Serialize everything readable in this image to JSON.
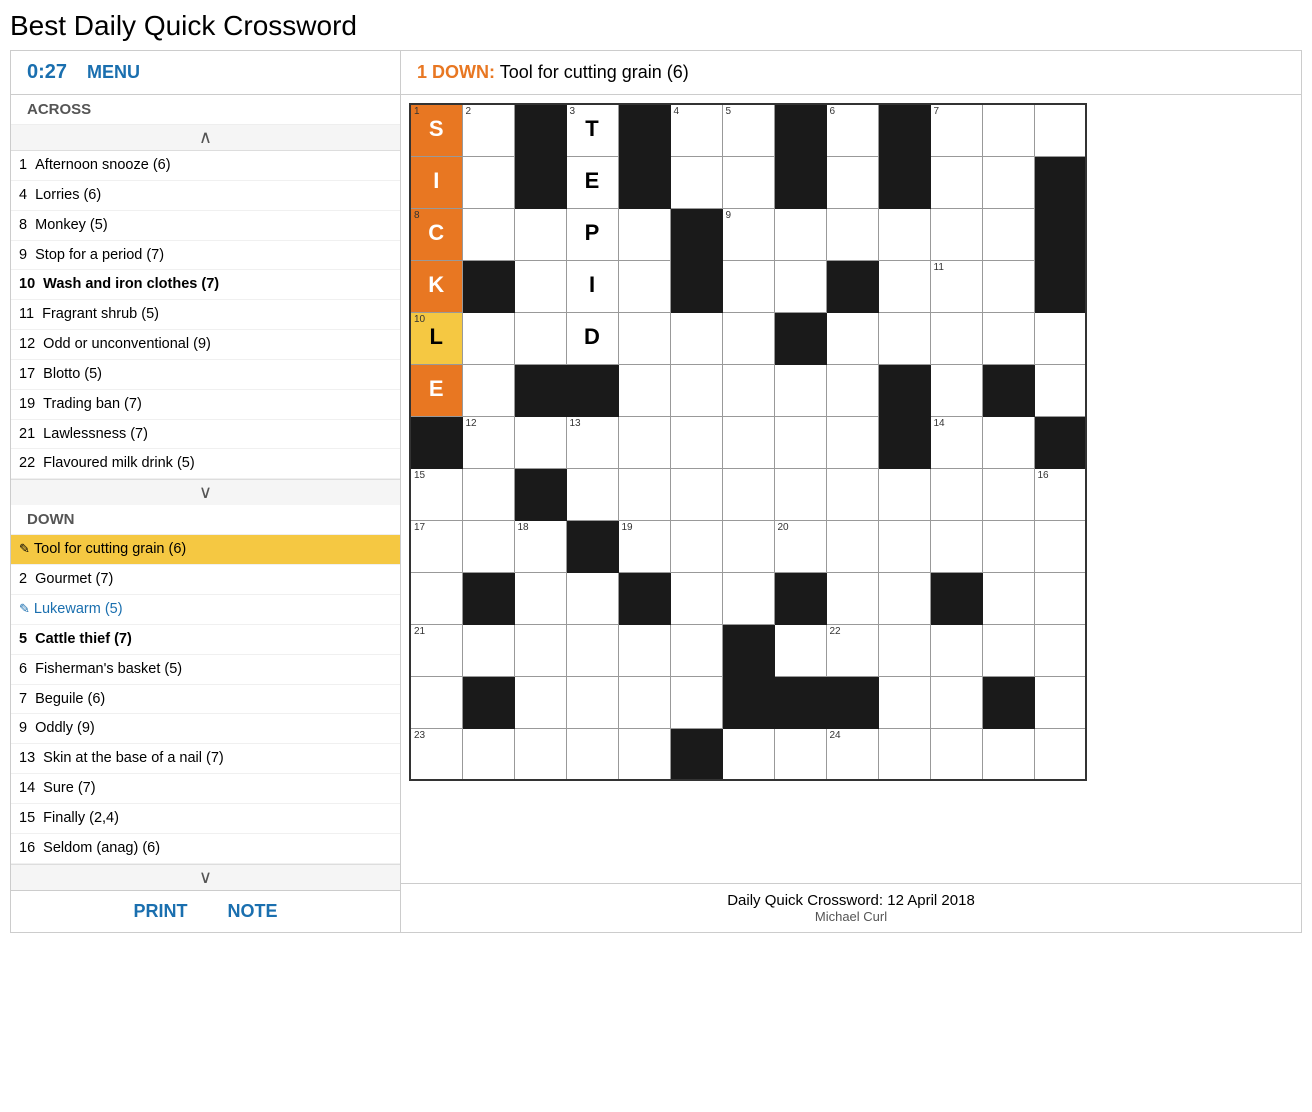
{
  "title": "Best Daily Quick Crossword",
  "header": {
    "timer": "0:27",
    "menu_label": "MENU",
    "active_clue_number": "1",
    "active_clue_direction": "DOWN",
    "active_clue_text": "Tool for cutting grain (6)"
  },
  "across_header": "ACROSS",
  "down_header": "DOWN",
  "across_clues": [
    {
      "number": "1",
      "text": "Afternoon snooze (6)",
      "completed": false,
      "active": false,
      "bold": false
    },
    {
      "number": "4",
      "text": "Lorries (6)",
      "completed": false,
      "active": false,
      "bold": false
    },
    {
      "number": "8",
      "text": "Monkey (5)",
      "completed": false,
      "active": false,
      "bold": false
    },
    {
      "number": "9",
      "text": "Stop for a period (7)",
      "completed": false,
      "active": false,
      "bold": false
    },
    {
      "number": "10",
      "text": "Wash and iron clothes (7)",
      "completed": false,
      "active": false,
      "bold": true
    },
    {
      "number": "11",
      "text": "Fragrant shrub (5)",
      "completed": false,
      "active": false,
      "bold": false
    },
    {
      "number": "12",
      "text": "Odd or unconventional (9)",
      "completed": false,
      "active": false,
      "bold": false
    },
    {
      "number": "17",
      "text": "Blotto (5)",
      "completed": false,
      "active": false,
      "bold": false
    },
    {
      "number": "19",
      "text": "Trading ban (7)",
      "completed": false,
      "active": false,
      "bold": false
    },
    {
      "number": "21",
      "text": "Lawlessness (7)",
      "completed": false,
      "active": false,
      "bold": false
    },
    {
      "number": "22",
      "text": "Flavoured milk drink (5)",
      "completed": false,
      "active": false,
      "bold": false
    }
  ],
  "down_clues": [
    {
      "number": "1",
      "text": "Tool for cutting grain (6)",
      "completed": false,
      "active": true,
      "icon": "pencil"
    },
    {
      "number": "2",
      "text": "Gourmet (7)",
      "completed": false,
      "active": false
    },
    {
      "number": "3",
      "text": "Lukewarm (5)",
      "completed": true,
      "active": false,
      "icon": "check"
    },
    {
      "number": "5",
      "text": "Cattle thief (7)",
      "completed": false,
      "active": false,
      "bold": true
    },
    {
      "number": "6",
      "text": "Fisherman's basket (5)",
      "completed": false,
      "active": false
    },
    {
      "number": "7",
      "text": "Beguile (6)",
      "completed": false,
      "active": false
    },
    {
      "number": "9",
      "text": "Oddly (9)",
      "completed": false,
      "active": false
    },
    {
      "number": "13",
      "text": "Skin at the base of a nail (7)",
      "completed": false,
      "active": false
    },
    {
      "number": "14",
      "text": "Sure (7)",
      "completed": false,
      "active": false
    },
    {
      "number": "15",
      "text": "Finally (2,4)",
      "completed": false,
      "active": false
    },
    {
      "number": "16",
      "text": "Seldom (anag) (6)",
      "completed": false,
      "active": false
    }
  ],
  "footer": {
    "print_label": "PRINT",
    "note_label": "NOTE",
    "attribution": "Daily Quick Crossword: 12 April 2018",
    "author": "Michael Curl"
  },
  "grid": {
    "rows": 13,
    "cols": 13
  }
}
